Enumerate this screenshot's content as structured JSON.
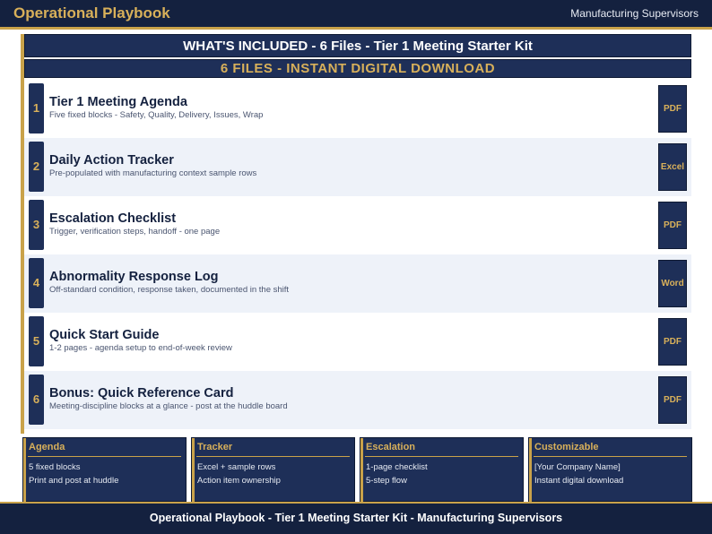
{
  "header": {
    "brand": "Operational Playbook",
    "audience": "Manufacturing Supervisors"
  },
  "banner": {
    "line1": "WHAT'S INCLUDED  -  6 Files  -  Tier 1 Meeting Starter Kit",
    "line2": "6 FILES  -  INSTANT DIGITAL DOWNLOAD"
  },
  "files": [
    {
      "num": "1",
      "title": "Tier 1 Meeting Agenda",
      "desc": "Five fixed blocks - Safety, Quality, Delivery, Issues, Wrap",
      "type": "PDF"
    },
    {
      "num": "2",
      "title": "Daily Action Tracker",
      "desc": "Pre-populated with manufacturing context sample rows",
      "type": "Excel"
    },
    {
      "num": "3",
      "title": "Escalation Checklist",
      "desc": "Trigger, verification steps, handoff - one page",
      "type": "PDF"
    },
    {
      "num": "4",
      "title": "Abnormality Response Log",
      "desc": "Off-standard condition, response taken, documented in the shift",
      "type": "Word"
    },
    {
      "num": "5",
      "title": "Quick Start Guide",
      "desc": "1-2 pages - agenda setup to end-of-week review",
      "type": "PDF"
    },
    {
      "num": "6",
      "title": "Bonus: Quick Reference Card",
      "desc": "Meeting-discipline blocks at a glance - post at the huddle board",
      "type": "PDF"
    }
  ],
  "cards": [
    {
      "title": "Agenda",
      "lines": [
        "5 fixed blocks",
        "Print and post at huddle"
      ]
    },
    {
      "title": "Tracker",
      "lines": [
        "Excel + sample rows",
        "Action item ownership"
      ]
    },
    {
      "title": "Escalation",
      "lines": [
        "1-page checklist",
        "5-step flow"
      ]
    },
    {
      "title": "Customizable",
      "lines": [
        "[Your Company Name]",
        "Instant digital download"
      ]
    }
  ],
  "footer": {
    "text": "Operational Playbook  -  Tier 1 Meeting Starter Kit  -  Manufacturing Supervisors"
  },
  "colors": {
    "navy": "#1e2f58",
    "dark_navy": "#14213f",
    "gold": "#c9a24a",
    "row_alt": "#eef2f9"
  }
}
